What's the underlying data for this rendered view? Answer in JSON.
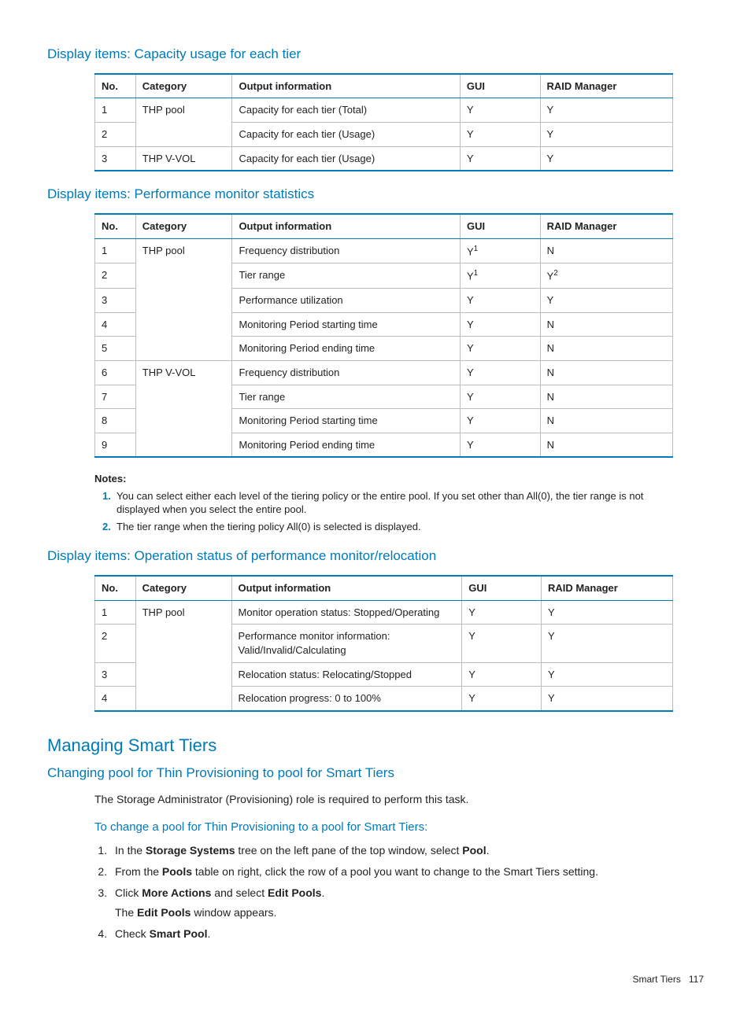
{
  "section1": {
    "title": "Display items: Capacity usage for each tier",
    "headers": {
      "no": "No.",
      "category": "Category",
      "output": "Output information",
      "gui": "GUI",
      "rm": "RAID Manager"
    },
    "rows": [
      {
        "no": "1",
        "category": "THP pool",
        "output": "Capacity for each tier (Total)",
        "gui": "Y",
        "rm": "Y"
      },
      {
        "no": "2",
        "category": "",
        "output": "Capacity for each tier (Usage)",
        "gui": "Y",
        "rm": "Y"
      },
      {
        "no": "3",
        "category": "THP V-VOL",
        "output": "Capacity for each tier (Usage)",
        "gui": "Y",
        "rm": "Y"
      }
    ]
  },
  "section2": {
    "title": "Display items: Performance monitor statistics",
    "headers": {
      "no": "No.",
      "category": "Category",
      "output": "Output information",
      "gui": "GUI",
      "rm": "RAID Manager"
    },
    "rows": [
      {
        "no": "1",
        "category": "THP pool",
        "output": "Frequency distribution",
        "gui": "Y",
        "gui_sup": "1",
        "rm": "N"
      },
      {
        "no": "2",
        "category": "",
        "output": "Tier range",
        "gui": "Y",
        "gui_sup": "1",
        "rm": "Y",
        "rm_sup": "2"
      },
      {
        "no": "3",
        "category": "",
        "output": "Performance utilization",
        "gui": "Y",
        "rm": "Y"
      },
      {
        "no": "4",
        "category": "",
        "output": "Monitoring Period starting time",
        "gui": "Y",
        "rm": "N"
      },
      {
        "no": "5",
        "category": "",
        "output": "Monitoring Period ending time",
        "gui": "Y",
        "rm": "N"
      },
      {
        "no": "6",
        "category": "THP V-VOL",
        "output": "Frequency distribution",
        "gui": "Y",
        "rm": "N"
      },
      {
        "no": "7",
        "category": "",
        "output": "Tier range",
        "gui": "Y",
        "rm": "N"
      },
      {
        "no": "8",
        "category": "",
        "output": "Monitoring Period starting time",
        "gui": "Y",
        "rm": "N"
      },
      {
        "no": "9",
        "category": "",
        "output": "Monitoring Period ending time",
        "gui": "Y",
        "rm": "N"
      }
    ],
    "notes_title": "Notes:",
    "notes": [
      {
        "num": "1.",
        "text": "You can select either each level of the tiering policy or the entire pool. If you set other than All(0), the tier range is not displayed when you select the entire pool."
      },
      {
        "num": "2.",
        "text": "The tier range when the tiering policy All(0) is selected is displayed."
      }
    ]
  },
  "section3": {
    "title": "Display items: Operation status of performance monitor/relocation",
    "headers": {
      "no": "No.",
      "category": "Category",
      "output": "Output information",
      "gui": "GUI",
      "rm": "RAID Manager"
    },
    "rows": [
      {
        "no": "1",
        "category": "THP pool",
        "output": "Monitor operation status: Stopped/Operating",
        "gui": "Y",
        "rm": "Y"
      },
      {
        "no": "2",
        "category": "",
        "output": "Performance monitor information: Valid/Invalid/Calculating",
        "gui": "Y",
        "rm": "Y"
      },
      {
        "no": "3",
        "category": "",
        "output": "Relocation status: Relocating/Stopped",
        "gui": "Y",
        "rm": "Y"
      },
      {
        "no": "4",
        "category": "",
        "output": "Relocation progress: 0 to 100%",
        "gui": "Y",
        "rm": "Y"
      }
    ]
  },
  "managing": {
    "title": "Managing Smart Tiers",
    "subtitle": "Changing pool for Thin Provisioning to pool for Smart Tiers",
    "intro": "The Storage Administrator (Provisioning) role is required to perform this task.",
    "procedure_title": "To change a pool for Thin Provisioning to a pool for Smart Tiers:",
    "step3_followup": "The <b>Edit Pools</b> window appears.",
    "steps_html": [
      "In the <b>Storage Systems</b> tree on the left pane of the top window, select <b>Pool</b>.",
      "From the <b>Pools</b> table on right, click the row of a pool you want to change to the Smart Tiers setting.",
      "Click <b>More Actions</b> and select <b>Edit Pools</b>.",
      "Check <b>Smart Pool</b>."
    ]
  },
  "footer": {
    "section": "Smart Tiers",
    "page": "117"
  }
}
